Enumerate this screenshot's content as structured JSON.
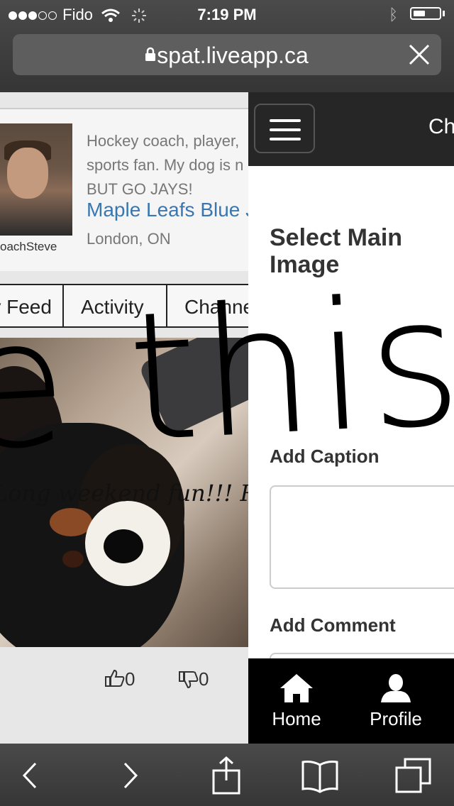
{
  "status_bar": {
    "carrier": "Fido",
    "time": "7:19 PM"
  },
  "browser": {
    "url": "spat.liveapp.ca"
  },
  "profile": {
    "username": "oachSteve",
    "bio": "Hockey coach, player,\nsports fan. My dog is n\nBUT GO JAYS!",
    "favorite_team": "Maple Leafs Blue J",
    "location": "London, ON"
  },
  "tabs": [
    {
      "label": "My Feed"
    },
    {
      "label": "Activity"
    },
    {
      "label": "Channels"
    }
  ],
  "post": {
    "caption_overlay": "Long weekend fun!!! R",
    "likes": "0",
    "dislikes": "0"
  },
  "overlay_text": "e this!",
  "panel": {
    "header_title": "Ch",
    "select_main_image": "Select Main Image",
    "add_caption_label": "Add Caption",
    "caption_value": "",
    "add_comment_label": "Add Comment",
    "comment_value": ""
  },
  "bottom_nav": [
    {
      "label": "Home",
      "icon": "home-icon"
    },
    {
      "label": "Profile",
      "icon": "profile-icon"
    }
  ],
  "colors": {
    "link_blue": "#3a77b0",
    "panel_header": "#262626",
    "nav_background": "#000000"
  }
}
